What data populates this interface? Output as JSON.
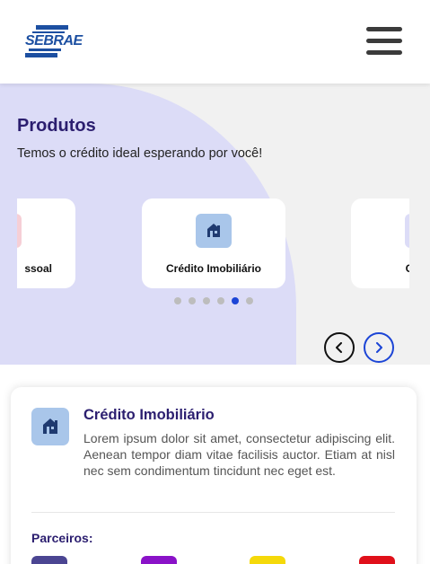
{
  "header": {
    "logo_text": "SEBRAE",
    "logo_color": "#1c4fa1",
    "menu_icon": "hamburger-menu-icon"
  },
  "hero": {
    "title": "Produtos",
    "subtitle": "Temos o crédito ideal esperando por você!",
    "blob_color": "#dcdcf7"
  },
  "carousel": {
    "cards": [
      {
        "label": "ssoal",
        "icon": "person-icon",
        "icon_color": "#f6cfd6"
      },
      {
        "label": "Crédito Imobiliário",
        "icon": "building-icon",
        "icon_color": "#a9c6ea"
      },
      {
        "label": "Crédi",
        "icon": "generic-icon",
        "icon_color": "#dcdcf7"
      }
    ],
    "dots_total": 6,
    "active_dot": 5,
    "active_color": "#1c45d6",
    "prev_icon": "chevron-left-icon",
    "next_icon": "chevron-right-icon"
  },
  "detail": {
    "icon": "building-icon",
    "title": "Crédito Imobiliário",
    "description": "Lorem ipsum dolor sit amet, consectetur adipiscing elit. Aenean tempor diam vitae facilisis auctor. Etiam at nisl nec sem condimentum tincidunt nec eget est.",
    "partners_label": "Parceiros:",
    "partners": [
      {
        "name": "partner-logo-1",
        "color": "#4b4592"
      },
      {
        "name": "partner-logo-2",
        "color": "#8a12c8"
      },
      {
        "name": "partner-logo-3",
        "color": "#f5d90a"
      },
      {
        "name": "partner-logo-4",
        "color": "#e0101a"
      }
    ]
  },
  "colors": {
    "title_purple": "#2b1e6f",
    "background_gray": "#f1f1f1"
  }
}
